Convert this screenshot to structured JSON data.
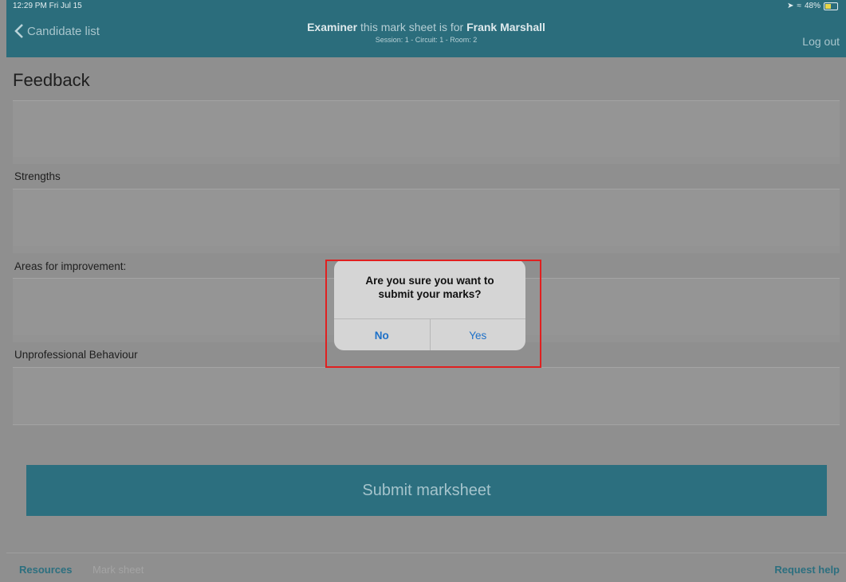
{
  "status_bar": {
    "time": "12:29 PM  Fri Jul 15",
    "battery": "48%"
  },
  "nav": {
    "back_label": "Candidate list",
    "title_prefix": "Examiner",
    "title_middle": " this mark sheet is for ",
    "candidate_name": "Frank Marshall",
    "subtitle": "Session: 1   -   Circuit: 1   -   Room: 2",
    "logout_label": "Log out"
  },
  "form": {
    "section_title": "Feedback",
    "strengths_label": "Strengths",
    "improvement_label": "Areas for improvement:",
    "unprofessional_label": "Unprofessional Behaviour",
    "submit_label": "Submit marksheet"
  },
  "bottom_bar": {
    "resources_label": "Resources",
    "marksheet_label": "Mark sheet",
    "help_label": "Request help"
  },
  "dialog": {
    "message_line1": "Are you sure you want to",
    "message_line2": "submit your marks?",
    "no_label": "No",
    "yes_label": "Yes"
  },
  "colors": {
    "accent": "#2b6d7c",
    "dialog_button": "#1d70c8",
    "highlight": "#e02020"
  }
}
